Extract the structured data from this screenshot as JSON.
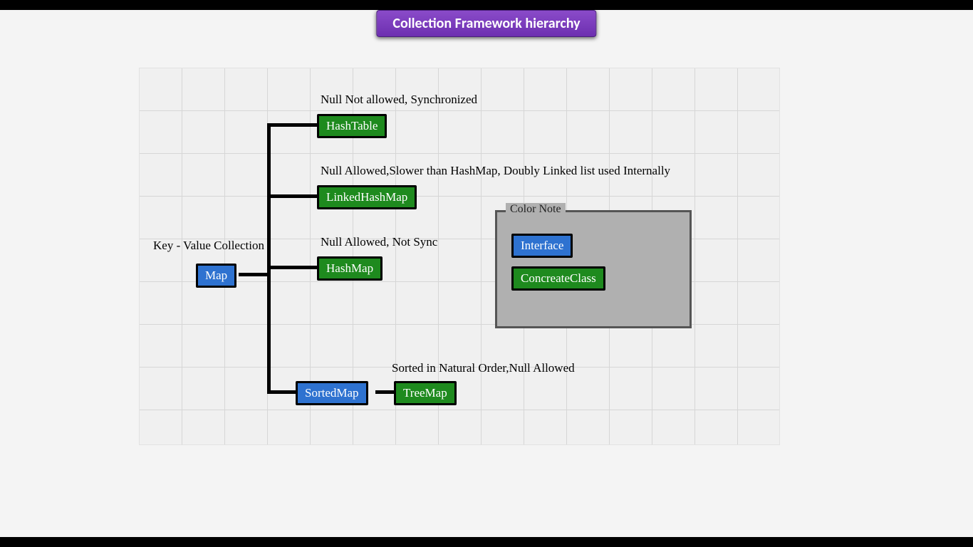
{
  "title": "Collection Framework hierarchy",
  "root_label": "Key - Value Collection",
  "root_node": "Map",
  "branches": {
    "hashtable": {
      "annot": "Null Not allowed, Synchronized",
      "node": "HashTable"
    },
    "linkedhashmap": {
      "annot": "Null Allowed,Slower than HashMap, Doubly Linked list used Internally",
      "node": "LinkedHashMap"
    },
    "hashmap": {
      "annot": "Null Allowed, Not Sync",
      "node": "HashMap"
    },
    "sortedmap": {
      "annot": "Sorted in Natural Order,Null Allowed",
      "interface": "SortedMap",
      "node": "TreeMap"
    }
  },
  "legend": {
    "title": "Color Note",
    "interface_label": "Interface",
    "concrete_label": "ConcreateClass"
  }
}
